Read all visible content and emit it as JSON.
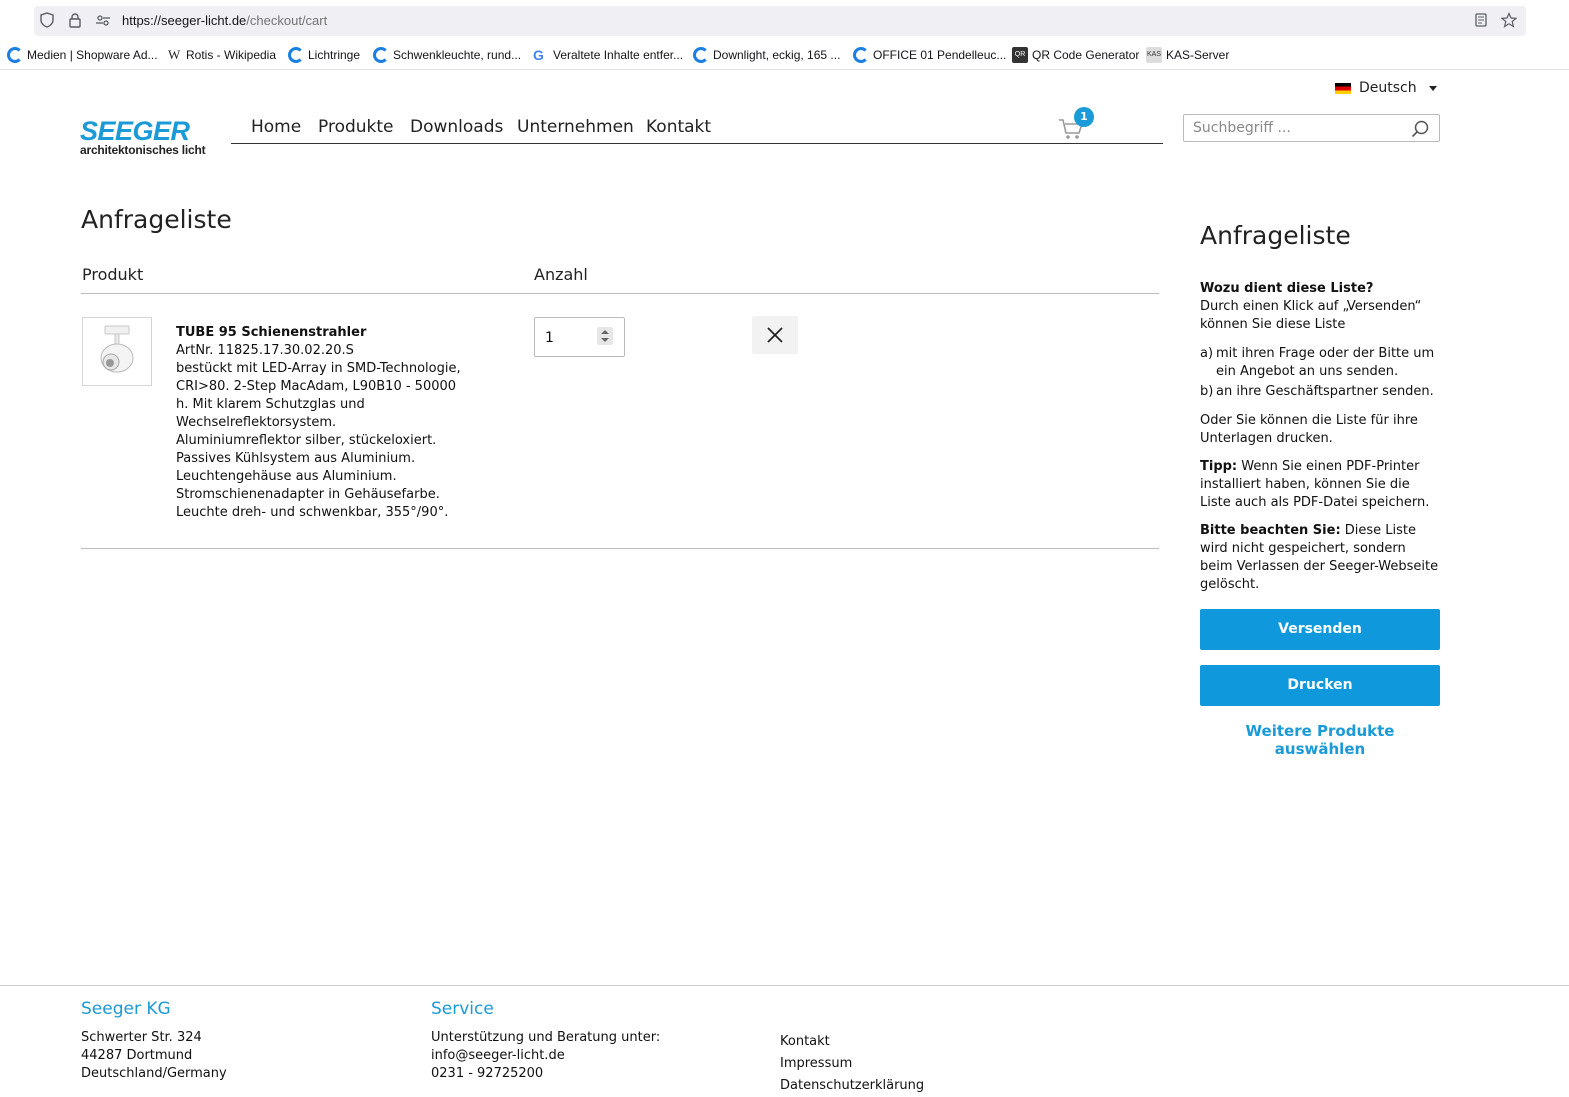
{
  "browser": {
    "url_host": "https://seeger-licht.de",
    "url_path": "/checkout/cart",
    "bookmarks": [
      {
        "label": "Medien | Shopware Ad...",
        "icon": "seeger-icon"
      },
      {
        "label": "Rotis - Wikipedia",
        "icon": "wikipedia-icon",
        "glyph": "W"
      },
      {
        "label": "Lichtringe",
        "icon": "seeger-icon"
      },
      {
        "label": "Schwenkleuchte, rund...",
        "icon": "seeger-icon"
      },
      {
        "label": "Veraltete Inhalte entfer...",
        "icon": "google-icon",
        "glyph": "G"
      },
      {
        "label": "Downlight, eckig, 165 ...",
        "icon": "seeger-icon"
      },
      {
        "label": "OFFICE 01 Pendelleuc...",
        "icon": "seeger-icon"
      },
      {
        "label": "QR Code Generator",
        "icon": "qr-icon",
        "glyph": "QR"
      },
      {
        "label": "KAS-Server",
        "icon": "kas-icon",
        "glyph": "KAS"
      }
    ]
  },
  "header": {
    "language": "Deutsch",
    "logo_main": "SEEGER",
    "logo_sub": "architektonisches licht",
    "nav": [
      "Home",
      "Produkte",
      "Downloads",
      "Unternehmen",
      "Kontakt"
    ],
    "cart_count": "1",
    "search_placeholder": "Suchbegriff ..."
  },
  "main": {
    "title": "Anfrageliste",
    "col_product": "Produkt",
    "col_quantity": "Anzahl",
    "item": {
      "name": "TUBE 95 Schienenstrahler",
      "article": "ArtNr. 11825.17.30.02.20.S",
      "description": "bestückt mit LED-Array in SMD-Technologie, CRI>80. 2-Step MacAdam, L90B10 - 50000 h. Mit klarem Schutzglas und Wechselreflektorsystem. Aluminiumreflektor silber, stückeloxiert. Passives Kühlsystem aus Aluminium. Leuchtengehäuse aus Aluminium. Stromschienenadapter in Gehäusefarbe. Leuchte dreh- und schwenkbar, 355°/90°.",
      "quantity": "1"
    }
  },
  "sidebar": {
    "title": "Anfrageliste",
    "q_heading": "Wozu dient diese Liste?",
    "q_text": "Durch einen Klick auf „Versenden“ können Sie diese Liste",
    "list": [
      {
        "label": "a)",
        "text": "mit ihren Frage oder der Bitte um ein Angebot an uns senden."
      },
      {
        "label": "b)",
        "text": "an ihre Geschäftspartner senden."
      }
    ],
    "print_text": "Oder Sie können die Liste für ihre Unterlagen drucken.",
    "tip_label": "Tipp:",
    "tip_text": "Wenn Sie einen PDF-Printer installiert haben, können Sie die Liste auch als PDF-Datei speichern.",
    "note_label": "Bitte beachten Sie:",
    "note_text": "Diese Liste wird nicht gespeichert, sondern beim Verlassen der Seeger-Webseite gelöscht.",
    "send_button": "Versenden",
    "print_button": "Drucken",
    "more_link": "Weitere Produkte auswählen"
  },
  "footer": {
    "company_heading": "Seeger KG",
    "address": [
      "Schwerter Str. 324",
      "44287 Dortmund",
      "Deutschland/Germany"
    ],
    "service_heading": "Service",
    "service_lines": [
      "Unterstützung und Beratung unter:",
      "info@seeger-licht.de",
      "0231 - 92725200"
    ],
    "links": [
      "Kontakt",
      "Impressum",
      "Datenschutzerklärung"
    ]
  },
  "colors": {
    "brand_blue": "#1a9ad6",
    "button_blue": "#0f99dc"
  }
}
